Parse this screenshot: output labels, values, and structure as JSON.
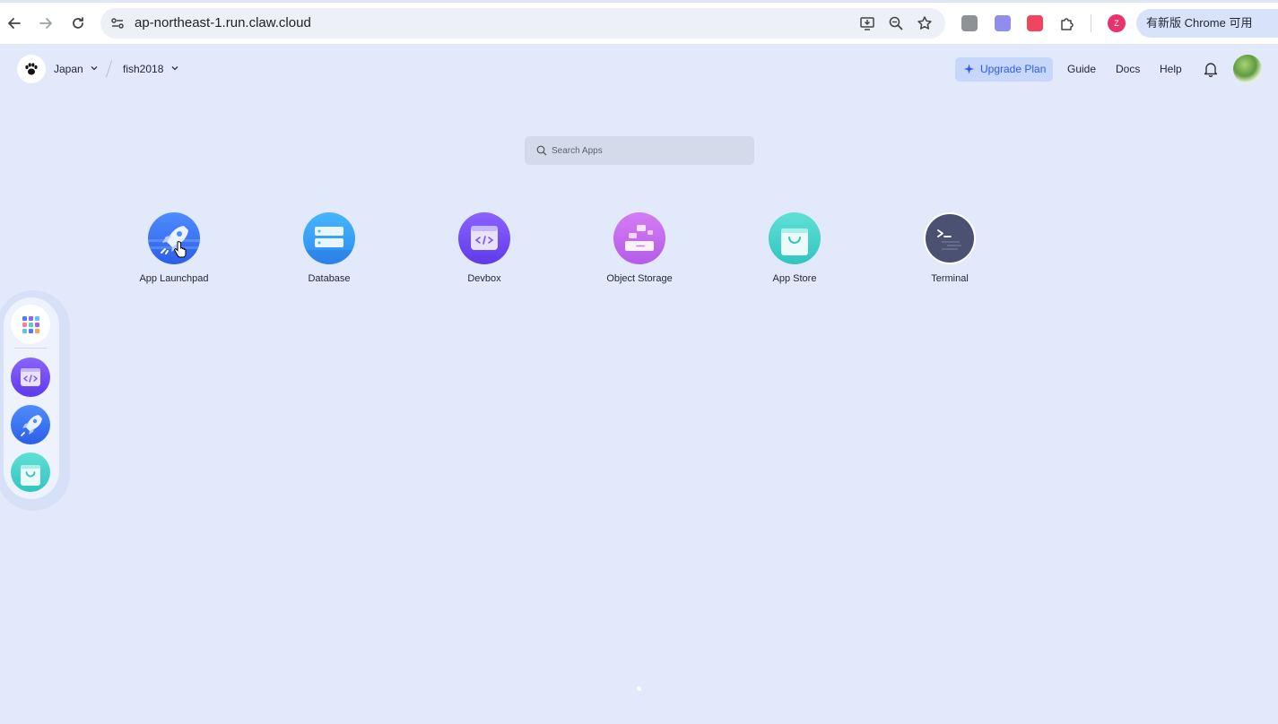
{
  "browser": {
    "url": "ap-northeast-1.run.claw.cloud",
    "profile_initial": "Z",
    "update_button": "有新版 Chrome 可用"
  },
  "header": {
    "region": "Japan",
    "workspace": "fish2018",
    "upgrade_label": "Upgrade Plan",
    "links": [
      "Guide",
      "Docs",
      "Help"
    ]
  },
  "search": {
    "placeholder": "Search Apps"
  },
  "apps": [
    {
      "label": "App Launchpad",
      "icon": "rocket-icon"
    },
    {
      "label": "Database",
      "icon": "database-icon"
    },
    {
      "label": "Devbox",
      "icon": "devbox-icon"
    },
    {
      "label": "Object Storage",
      "icon": "object-storage-icon"
    },
    {
      "label": "App Store",
      "icon": "app-store-icon"
    },
    {
      "label": "Terminal",
      "icon": "terminal-icon"
    }
  ],
  "dock": {
    "items": [
      "apps-grid-icon",
      "devbox-icon",
      "rocket-icon",
      "app-store-icon"
    ]
  },
  "colors": {
    "background": "#e1e9fb",
    "accent": "#2f5ce8"
  }
}
